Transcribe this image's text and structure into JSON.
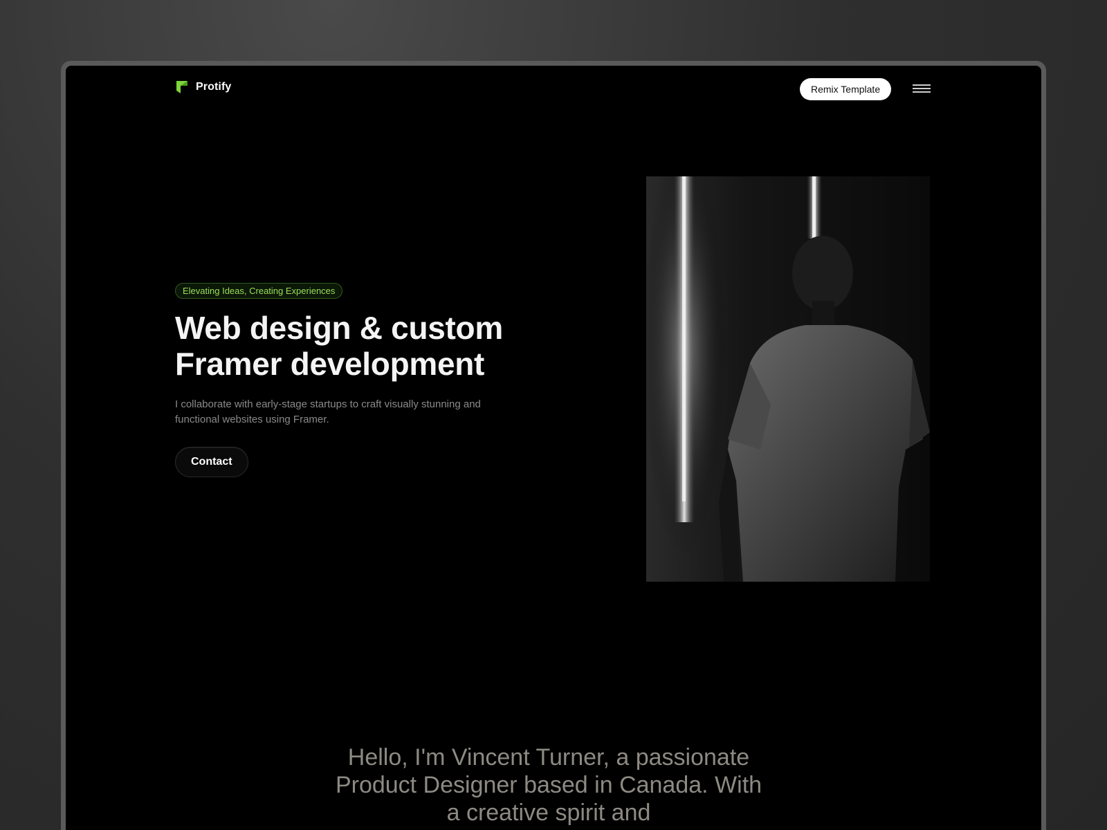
{
  "nav": {
    "logo_text": "Protify",
    "remix_label": "Remix Template"
  },
  "hero": {
    "badge": "Elevating Ideas, Creating Experiences",
    "headline": "Web design & custom Framer development",
    "lede": "I collaborate with early-stage startups to craft visually stunning and functional websites using Framer.",
    "contact_label": "Contact"
  },
  "intro": {
    "text": "Hello, I'm Vincent Turner, a passionate Product Designer based in Canada. With a creative spirit and"
  },
  "colors": {
    "accent": "#9be05a",
    "logo": "#7dd33a",
    "background": "#000000"
  },
  "icons": {
    "menu": "hamburger-icon",
    "logo": "protify-logo-icon"
  }
}
